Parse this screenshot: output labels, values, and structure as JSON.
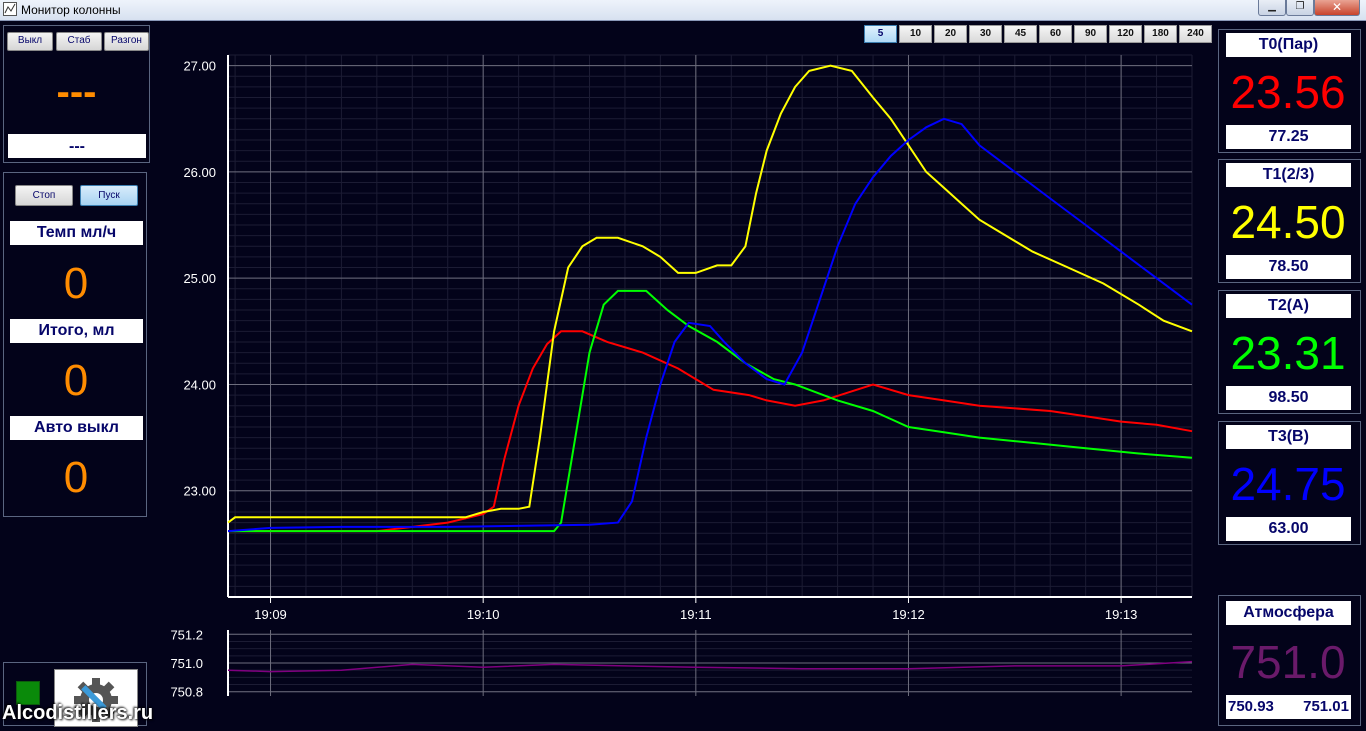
{
  "window": {
    "title": "Монитор колонны"
  },
  "mode_buttons": [
    "Выкл",
    "Стаб",
    "Разгон"
  ],
  "mode_display": {
    "value": "---",
    "label": "---"
  },
  "control": {
    "stop_label": "Стоп",
    "start_label": "Пуск",
    "rate_label": "Темп мл/ч",
    "rate_value": "0",
    "total_label": "Итого, мл",
    "total_value": "0",
    "auto_off_label": "Авто выкл",
    "auto_off_value": "0"
  },
  "range_buttons": [
    "5",
    "10",
    "20",
    "30",
    "45",
    "60",
    "90",
    "120",
    "180",
    "240"
  ],
  "selected_range": "5",
  "sensors": [
    {
      "title": "T0(Пар)",
      "value": "23.56",
      "sub": "77.25",
      "color": "#ff0000"
    },
    {
      "title": "T1(2/3)",
      "value": "24.50",
      "sub": "78.50",
      "color": "#ffff00"
    },
    {
      "title": "T2(A)",
      "value": "23.31",
      "sub": "98.50",
      "color": "#00ff00"
    },
    {
      "title": "T3(B)",
      "value": "24.75",
      "sub": "63.00",
      "color": "#0000ff"
    }
  ],
  "atmosphere": {
    "title": "Атмосфера",
    "value": "751.0",
    "min": "750.93",
    "max": "751.01",
    "color": "#6a1a6a"
  },
  "watermark": "Alcodistillers.ru",
  "chart_data": [
    {
      "type": "line",
      "x_ticks": [
        "19:09",
        "19:10",
        "19:11",
        "19:12",
        "19:13"
      ],
      "y_ticks": [
        "27.00",
        "26.00",
        "25.00",
        "24.00",
        "23.00"
      ],
      "ylim": [
        22.0,
        27.1
      ],
      "xlim": [
        "19:08:48",
        "19:13:20"
      ],
      "grid": true,
      "series": [
        {
          "color": "#ff0000",
          "points": [
            [
              "19:08:48",
              22.62
            ],
            [
              "19:09:30",
              22.62
            ],
            [
              "19:09:50",
              22.7
            ],
            [
              "19:10:00",
              22.78
            ],
            [
              "19:10:03",
              22.85
            ],
            [
              "19:10:06",
              23.3
            ],
            [
              "19:10:10",
              23.8
            ],
            [
              "19:10:14",
              24.15
            ],
            [
              "19:10:18",
              24.38
            ],
            [
              "19:10:22",
              24.5
            ],
            [
              "19:10:28",
              24.5
            ],
            [
              "19:10:35",
              24.4
            ],
            [
              "19:10:45",
              24.3
            ],
            [
              "19:10:55",
              24.15
            ],
            [
              "19:11:05",
              23.95
            ],
            [
              "19:11:15",
              23.9
            ],
            [
              "19:11:20",
              23.85
            ],
            [
              "19:11:28",
              23.8
            ],
            [
              "19:11:36",
              23.85
            ],
            [
              "19:11:50",
              24.0
            ],
            [
              "19:12:00",
              23.9
            ],
            [
              "19:12:10",
              23.85
            ],
            [
              "19:12:20",
              23.8
            ],
            [
              "19:12:40",
              23.75
            ],
            [
              "19:12:50",
              23.7
            ],
            [
              "19:13:00",
              23.65
            ],
            [
              "19:13:10",
              23.62
            ],
            [
              "19:13:20",
              23.56
            ]
          ]
        },
        {
          "color": "#ffff00",
          "points": [
            [
              "19:08:48",
              22.7
            ],
            [
              "19:08:50",
              22.75
            ],
            [
              "19:09:55",
              22.75
            ],
            [
              "19:10:00",
              22.8
            ],
            [
              "19:10:05",
              22.83
            ],
            [
              "19:10:10",
              22.83
            ],
            [
              "19:10:13",
              22.85
            ],
            [
              "19:10:16",
              23.5
            ],
            [
              "19:10:20",
              24.5
            ],
            [
              "19:10:24",
              25.1
            ],
            [
              "19:10:28",
              25.3
            ],
            [
              "19:10:32",
              25.38
            ],
            [
              "19:10:38",
              25.38
            ],
            [
              "19:10:45",
              25.3
            ],
            [
              "19:10:50",
              25.2
            ],
            [
              "19:10:55",
              25.05
            ],
            [
              "19:11:00",
              25.05
            ],
            [
              "19:11:06",
              25.12
            ],
            [
              "19:11:10",
              25.12
            ],
            [
              "19:11:14",
              25.3
            ],
            [
              "19:11:17",
              25.8
            ],
            [
              "19:11:20",
              26.2
            ],
            [
              "19:11:24",
              26.55
            ],
            [
              "19:11:28",
              26.8
            ],
            [
              "19:11:32",
              26.95
            ],
            [
              "19:11:38",
              27.0
            ],
            [
              "19:11:44",
              26.95
            ],
            [
              "19:11:50",
              26.7
            ],
            [
              "19:11:55",
              26.5
            ],
            [
              "19:12:00",
              26.25
            ],
            [
              "19:12:05",
              26.0
            ],
            [
              "19:12:10",
              25.85
            ],
            [
              "19:12:15",
              25.7
            ],
            [
              "19:12:20",
              25.55
            ],
            [
              "19:12:25",
              25.45
            ],
            [
              "19:12:30",
              25.35
            ],
            [
              "19:12:35",
              25.25
            ],
            [
              "19:12:45",
              25.1
            ],
            [
              "19:12:55",
              24.95
            ],
            [
              "19:13:05",
              24.75
            ],
            [
              "19:13:12",
              24.6
            ],
            [
              "19:13:20",
              24.5
            ]
          ]
        },
        {
          "color": "#00ff00",
          "points": [
            [
              "19:08:48",
              22.62
            ],
            [
              "19:10:20",
              22.62
            ],
            [
              "19:10:22",
              22.7
            ],
            [
              "19:10:26",
              23.5
            ],
            [
              "19:10:30",
              24.3
            ],
            [
              "19:10:34",
              24.75
            ],
            [
              "19:10:38",
              24.88
            ],
            [
              "19:10:46",
              24.88
            ],
            [
              "19:10:52",
              24.7
            ],
            [
              "19:10:58",
              24.55
            ],
            [
              "19:11:06",
              24.4
            ],
            [
              "19:11:14",
              24.2
            ],
            [
              "19:11:22",
              24.05
            ],
            [
              "19:11:28",
              24.0
            ],
            [
              "19:11:40",
              23.85
            ],
            [
              "19:11:50",
              23.75
            ],
            [
              "19:12:00",
              23.6
            ],
            [
              "19:12:10",
              23.55
            ],
            [
              "19:12:20",
              23.5
            ],
            [
              "19:12:35",
              23.45
            ],
            [
              "19:12:50",
              23.4
            ],
            [
              "19:13:05",
              23.35
            ],
            [
              "19:13:20",
              23.31
            ]
          ]
        },
        {
          "color": "#0000ff",
          "points": [
            [
              "19:08:48",
              22.62
            ],
            [
              "19:09:00",
              22.65
            ],
            [
              "19:09:20",
              22.66
            ],
            [
              "19:09:50",
              22.66
            ],
            [
              "19:10:30",
              22.68
            ],
            [
              "19:10:38",
              22.7
            ],
            [
              "19:10:42",
              22.9
            ],
            [
              "19:10:46",
              23.5
            ],
            [
              "19:10:50",
              24.0
            ],
            [
              "19:10:54",
              24.4
            ],
            [
              "19:10:58",
              24.58
            ],
            [
              "19:11:04",
              24.55
            ],
            [
              "19:11:08",
              24.4
            ],
            [
              "19:11:14",
              24.2
            ],
            [
              "19:11:20",
              24.05
            ],
            [
              "19:11:25",
              24.0
            ],
            [
              "19:11:30",
              24.3
            ],
            [
              "19:11:35",
              24.8
            ],
            [
              "19:11:40",
              25.3
            ],
            [
              "19:11:45",
              25.7
            ],
            [
              "19:11:50",
              25.95
            ],
            [
              "19:11:55",
              26.15
            ],
            [
              "19:12:00",
              26.3
            ],
            [
              "19:12:05",
              26.42
            ],
            [
              "19:12:10",
              26.5
            ],
            [
              "19:12:15",
              26.45
            ],
            [
              "19:12:20",
              26.25
            ],
            [
              "19:12:30",
              26.0
            ],
            [
              "19:12:40",
              25.75
            ],
            [
              "19:12:50",
              25.5
            ],
            [
              "19:13:00",
              25.25
            ],
            [
              "19:13:10",
              25.0
            ],
            [
              "19:13:20",
              24.75
            ]
          ]
        }
      ]
    },
    {
      "type": "line",
      "y_ticks": [
        "751.2",
        "751.0",
        "750.8"
      ],
      "ylim": [
        750.77,
        751.23
      ],
      "xlim": [
        "19:08:48",
        "19:13:20"
      ],
      "grid": true,
      "series": [
        {
          "color": "#800080",
          "points": [
            [
              "19:08:48",
              750.95
            ],
            [
              "19:09:00",
              750.94
            ],
            [
              "19:09:20",
              750.95
            ],
            [
              "19:09:40",
              750.99
            ],
            [
              "19:10:00",
              750.97
            ],
            [
              "19:10:20",
              750.99
            ],
            [
              "19:10:40",
              750.98
            ],
            [
              "19:11:00",
              750.97
            ],
            [
              "19:11:30",
              750.96
            ],
            [
              "19:12:00",
              750.96
            ],
            [
              "19:12:30",
              750.98
            ],
            [
              "19:13:00",
              750.98
            ],
            [
              "19:13:20",
              751.01
            ]
          ]
        }
      ]
    }
  ]
}
